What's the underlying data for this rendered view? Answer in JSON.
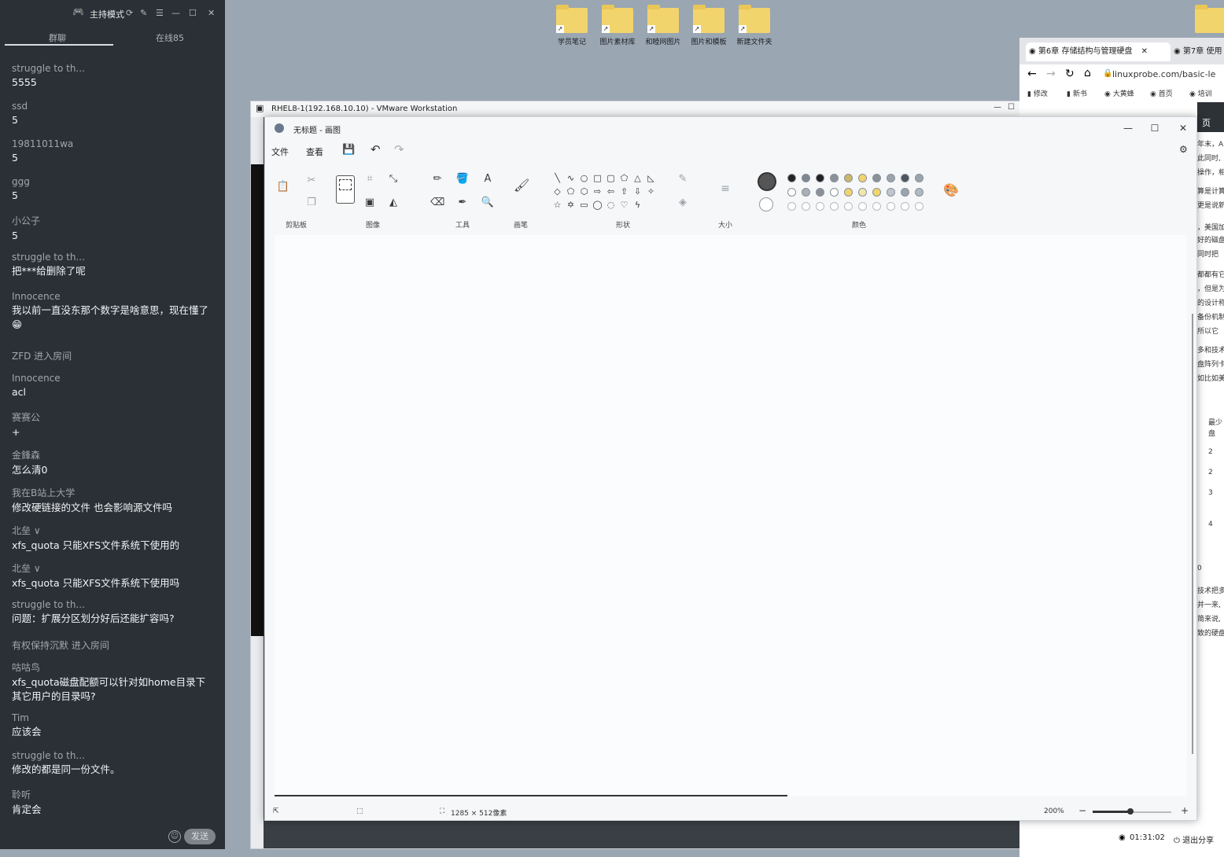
{
  "chat": {
    "header": {
      "mode_label": "主持模式"
    },
    "tabs": {
      "chat": "群聊",
      "online": "在线85"
    },
    "messages": [
      {
        "name": "struggle to th...",
        "text": "5555"
      },
      {
        "name": "ssd",
        "text": "5"
      },
      {
        "name": "19811011wa",
        "text": "5"
      },
      {
        "name": "ggg",
        "text": "5"
      },
      {
        "name": "小公子",
        "text": "5"
      },
      {
        "name": "struggle to th...",
        "text": "把***给删除了呢"
      },
      {
        "name": "Innocence",
        "text": "我以前一直没东那个数字是啥意思，现在懂了😁"
      },
      {
        "name": "ZFD 进入房间",
        "text": ""
      },
      {
        "name": "Innocence",
        "text": "acl"
      },
      {
        "name": "赛赛公",
        "text": "+"
      },
      {
        "name": "金鋒森",
        "text": "怎么清0"
      },
      {
        "name": "我在B站上大学",
        "text": "修改硬链接的文件 也会影响源文件吗"
      },
      {
        "name": "北垒 ∨",
        "text": "xfs_quota 只能XFS文件系统下使用的"
      },
      {
        "name": "北垒 ∨",
        "text": "xfs_quota 只能XFS文件系统下使用吗"
      },
      {
        "name": "struggle to th...",
        "text": "问题：扩展分区划分好后还能扩容吗?"
      },
      {
        "name": "有权保持沉默 进入房间",
        "text": ""
      },
      {
        "name": "咕咕鸟",
        "text": "xfs_quota磁盘配额可以针对如home目录下其它用户的目录吗?"
      },
      {
        "name": "Tim",
        "text": "应该会"
      },
      {
        "name": "struggle to th...",
        "text": "修改的都是同一份文件。"
      },
      {
        "name": "聆听",
        "text": "肯定会"
      }
    ],
    "send_label": "发送"
  },
  "desktop": {
    "folders": [
      "学员笔记",
      "图片素材库",
      "和睦网图片",
      "图片和模板",
      "新建文件夹"
    ]
  },
  "vmware": {
    "title": "RHEL8-1(192.168.10.10) - VMware Workstation"
  },
  "browser": {
    "tab1": "第6章 存储结构与管理硬盘",
    "tab2": "第7章 使用",
    "url": "linuxprobe.com/basic-le",
    "bookmarks": [
      "修改",
      "新书",
      "大黄蜂",
      "首页",
      "培训"
    ],
    "page_header": "页",
    "snippets": [
      "年末，A",
      "此同时,",
      "操作，相",
      "算是计算",
      "更是说新",
      "，美国加",
      "好的磁盘",
      "同时把",
      "都都有它",
      "，但是为",
      "的设计称",
      "备份机制",
      "所以它",
      "多和技术",
      "盘阵列卡",
      "如比如美",
      "最少",
      "盘",
      "2",
      "2",
      "3",
      "4",
      "0",
      "技术把多",
      "并一来,",
      "简来说,",
      "致的硬盘"
    ]
  },
  "paint": {
    "title": "无标题 - 画图",
    "menu": [
      "文件",
      "查看"
    ],
    "groups": [
      "剪贴板",
      "图像",
      "工具",
      "画笔",
      "形状",
      "大小",
      "颜色"
    ],
    "status": {
      "size": "1285 × 512像素",
      "zoom": "200%"
    },
    "colors_row1": [
      "#222222",
      "#7d8792",
      "#222222",
      "#8a9199",
      "#c9b86a",
      "#f2d46d",
      "#8a9199",
      "#9aa4ae",
      "#4a5560",
      "#9aa4ae"
    ],
    "colors_row2": [
      "#ffffff",
      "#a8b0b8",
      "#8a9199",
      "#ffffff",
      "#f2d46d",
      "#f1e6b0",
      "#f2d46d",
      "#c0c6cc",
      "#9aa4ae",
      "#b0b8c0"
    ]
  },
  "taskbar": {
    "timer": "01:31:02",
    "stop_share": "退出分享"
  }
}
